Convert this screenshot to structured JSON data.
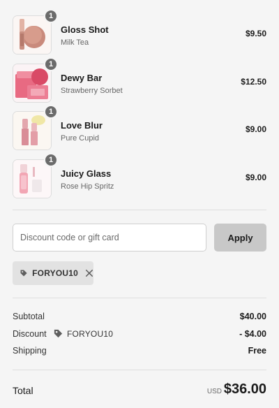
{
  "items": [
    {
      "name": "Gloss Shot",
      "variant": "Milk Tea",
      "price": "$9.50",
      "quantity": "1",
      "image_icon": "lip-gloss-product-image"
    },
    {
      "name": "Dewy Bar",
      "variant": "Strawberry Sorbet",
      "price": "$12.50",
      "quantity": "1",
      "image_icon": "blush-palette-product-image"
    },
    {
      "name": "Love Blur",
      "variant": "Pure Cupid",
      "price": "$9.00",
      "quantity": "1",
      "image_icon": "lipstick-product-image"
    },
    {
      "name": "Juicy Glass",
      "variant": "Rose Hip Spritz",
      "price": "$9.00",
      "quantity": "1",
      "image_icon": "lip-oil-product-image"
    }
  ],
  "discount": {
    "placeholder": "Discount code or gift card",
    "value": "",
    "apply_label": "Apply",
    "applied_code": "FORYOU10"
  },
  "summary": {
    "subtotal_label": "Subtotal",
    "subtotal_value": "$40.00",
    "discount_label": "Discount",
    "discount_code": "FORYOU10",
    "discount_value": "- $4.00",
    "shipping_label": "Shipping",
    "shipping_value": "Free",
    "total_label": "Total",
    "currency": "USD",
    "total_value": "$36.00"
  },
  "colors": {
    "background": "#f5f5f5",
    "badge": "#6b6b6b",
    "apply_button": "#c8c8c8",
    "tag_background": "#e2e2e2"
  }
}
